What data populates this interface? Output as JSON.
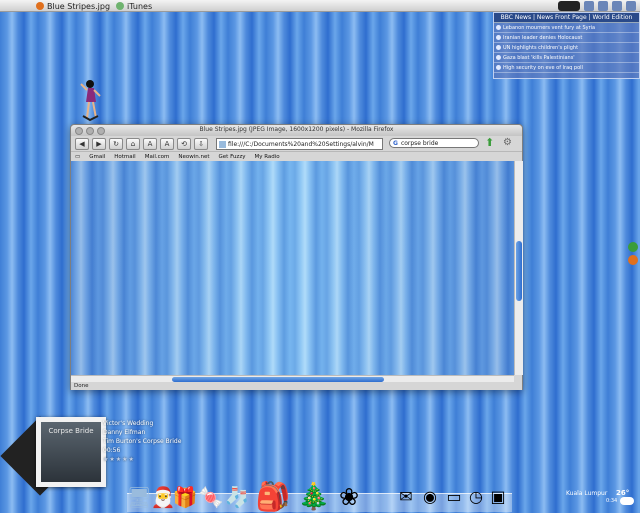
{
  "taskbar": {
    "tasks": [
      {
        "label": "Blue Stripes.jpg",
        "icon": "firefox-icon"
      },
      {
        "label": "iTunes",
        "icon": "itunes-icon"
      }
    ]
  },
  "news": {
    "header": "BBC News | News Front Page | World Edition",
    "items": [
      "Lebanon mourners vent fury at Syria",
      "Iranian leader denies Holocaust",
      "UN highlights children's plight",
      "Gaza blast 'kills Palestinians'",
      "High security on eve of Iraq poll"
    ]
  },
  "browser": {
    "title": "Blue Stripes.jpg (JPEG Image, 1600x1200 pixels) - Mozilla Firefox",
    "url": "file:///C:/Documents%20and%20Settings/alvin/M",
    "search_value": "corpse bride",
    "bookmarks": [
      "Gmail",
      "Hotmail",
      "Mail.com",
      "Neowin.net",
      "Get Fuzzy",
      "My Radio"
    ],
    "status": "Done"
  },
  "player": {
    "album_art_text": "Corpse Bride",
    "track": "Victor's Wedding",
    "artist": "Danny Elfman",
    "album": "Tim Burton's Corpse Bride",
    "time": "00:56",
    "rating_stars": "★★★★★"
  },
  "dock": {
    "items": [
      "my-computer-icon",
      "santa-icon",
      "gift-icon",
      "candy-cane-icon",
      "stocking-icon",
      "santa-bag-icon",
      "christmas-tree-icon",
      "wreath-icon",
      "mail-icon",
      "speaker-icon",
      "drive-icon",
      "clock-icon",
      "package-icon"
    ]
  },
  "weather": {
    "city": "Kuala Lumpur",
    "temp": "26°",
    "time": "0:34"
  },
  "colors": {
    "accent": "#2f6ecf",
    "stripe_light": "#b8dbf9"
  }
}
